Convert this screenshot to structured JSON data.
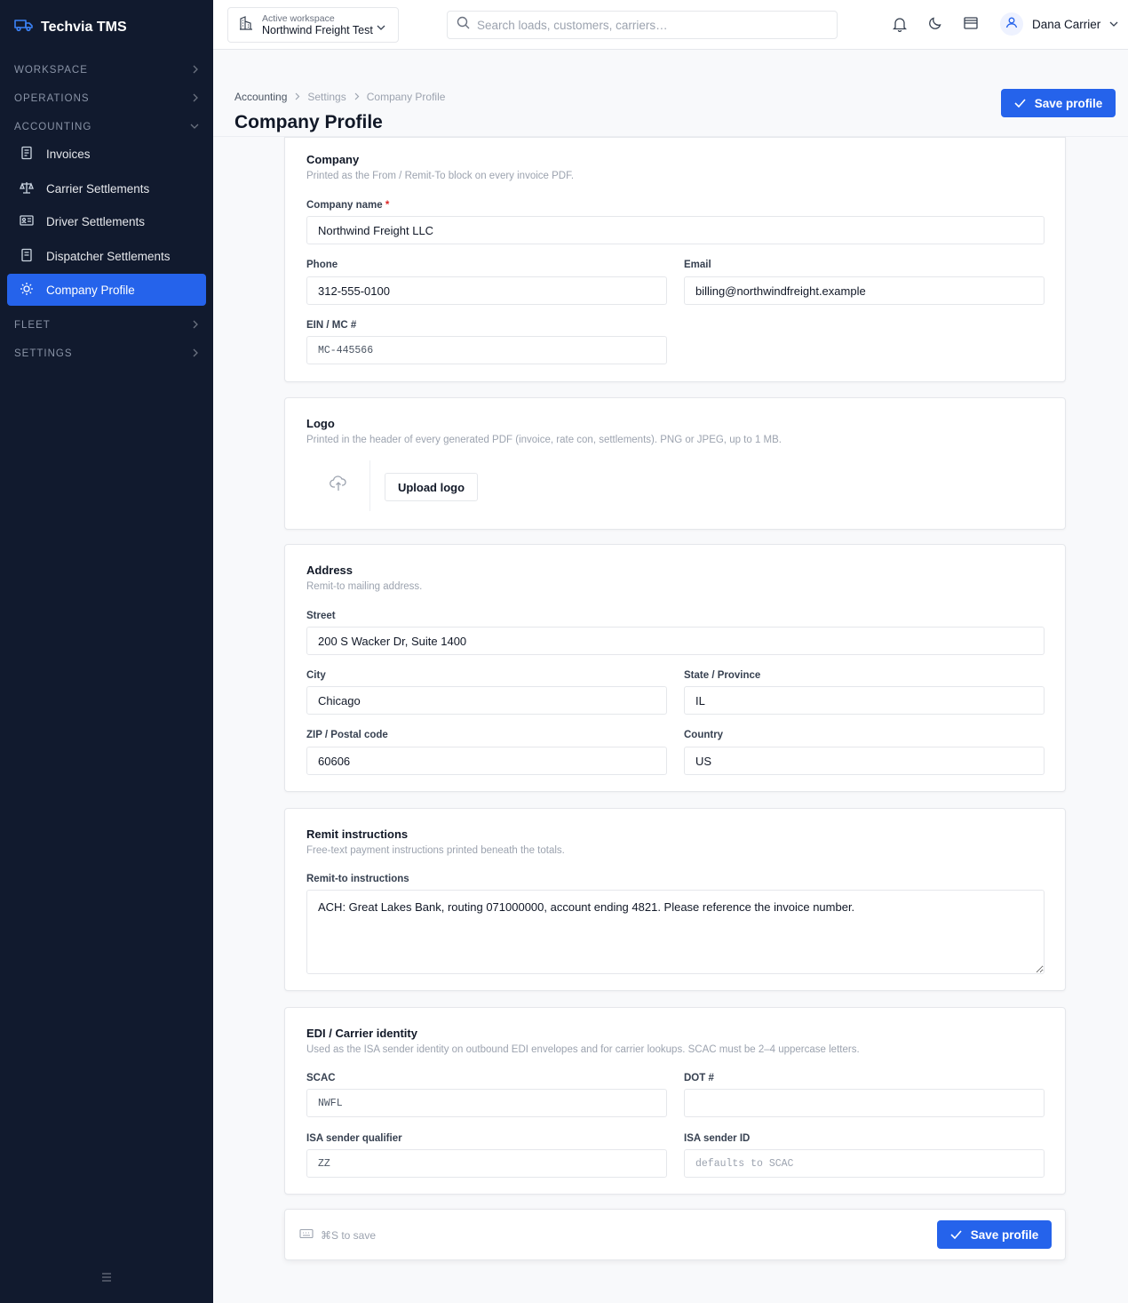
{
  "brand": {
    "name": "Techvia TMS",
    "accent": "#2563eb"
  },
  "sidebar": {
    "groups": {
      "workspace": "WORKSPACE",
      "operations": "OPERATIONS",
      "accounting": "ACCOUNTING",
      "fleet": "FLEET",
      "settings": "SETTINGS"
    },
    "items": [
      {
        "label": "Invoices",
        "icon": "invoice-icon"
      },
      {
        "label": "Carrier Settlements",
        "icon": "scale-icon"
      },
      {
        "label": "Driver Settlements",
        "icon": "id-card-icon"
      },
      {
        "label": "Dispatcher Settlements",
        "icon": "document-icon"
      },
      {
        "label": "Company Profile",
        "icon": "sun-icon",
        "active": true
      }
    ]
  },
  "topbar": {
    "workspace_label": "Active workspace",
    "workspace_name": "Northwind Freight Test",
    "search_placeholder": "Search loads, customers, carriers…",
    "user_name": "Dana Carrier"
  },
  "header": {
    "breadcrumb": [
      "Accounting",
      "Settings",
      "Company Profile"
    ],
    "title": "Company Profile",
    "save_label": "Save profile"
  },
  "company": {
    "title": "Company",
    "desc": "Printed as the From / Remit-To block on every invoice PDF.",
    "name_label": "Company name",
    "name_required": "*",
    "name_value": "Northwind Freight LLC",
    "phone_label": "Phone",
    "phone_value": "312-555-0100",
    "email_label": "Email",
    "email_value": "billing@northwindfreight.example",
    "ein_label": "EIN / MC #",
    "ein_value": "MC-445566"
  },
  "logo": {
    "title": "Logo",
    "desc": "Printed in the header of every generated PDF (invoice, rate con, settlements). PNG or JPEG, up to 1 MB.",
    "upload_label": "Upload logo"
  },
  "address": {
    "title": "Address",
    "desc": "Remit-to mailing address.",
    "street_label": "Street",
    "street_value": "200 S Wacker Dr, Suite 1400",
    "city_label": "City",
    "city_value": "Chicago",
    "state_label": "State / Province",
    "state_value": "IL",
    "zip_label": "ZIP / Postal code",
    "zip_value": "60606",
    "country_label": "Country",
    "country_value": "US"
  },
  "remit": {
    "title": "Remit instructions",
    "desc": "Free-text payment instructions printed beneath the totals.",
    "label": "Remit-to instructions",
    "value": "ACH: Great Lakes Bank, routing 071000000, account ending 4821. Please reference the invoice number."
  },
  "edi": {
    "title": "EDI / Carrier identity",
    "desc": "Used as the ISA sender identity on outbound EDI envelopes and for carrier lookups. SCAC must be 2–4 uppercase letters.",
    "scac_label": "SCAC",
    "scac_value": "NWFL",
    "dot_label": "DOT #",
    "dot_value": "",
    "qualifier_label": "ISA sender qualifier",
    "qualifier_value": "ZZ",
    "sender_id_label": "ISA sender ID",
    "sender_id_placeholder": "defaults to SCAC"
  },
  "footer": {
    "shortcut": "⌘S to save",
    "save_label": "Save profile"
  }
}
